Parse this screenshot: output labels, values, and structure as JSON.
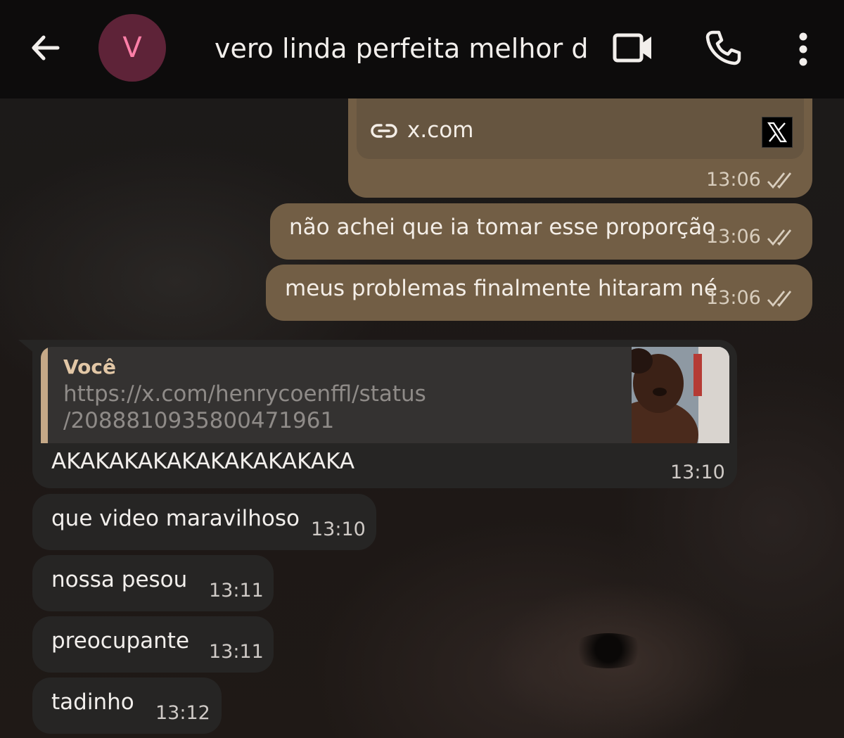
{
  "header": {
    "avatar_letter": "V",
    "contact_name": "vero linda perfeita melhor d...",
    "icons": [
      "arrow-back-icon",
      "video-call-icon",
      "phone-call-icon",
      "more-vert-icon"
    ]
  },
  "colors": {
    "outgoing_bubble": "#725e45",
    "incoming_bubble": "#262524",
    "avatar_bg": "#5e2338",
    "avatar_letter": "#ff7fa8",
    "reply_accent": "#c5a887"
  },
  "messages": {
    "link_preview": {
      "domain": "x.com",
      "time": "13:06",
      "brand_icon": "x-logo-icon"
    },
    "out1": {
      "text": "não achei que ia tomar esse proporção",
      "time": "13:06"
    },
    "out2": {
      "text": "meus problemas finalmente hitaram né",
      "time": "13:06"
    },
    "reply": {
      "author": "Você",
      "url_line1": "https://x.com/henrycoenffl/status",
      "url_line2": "/2088810935800471961",
      "text": "AKAKAKAKAKAKAKAKAKAKA",
      "time": "13:10"
    },
    "in1": {
      "text": "que video maravilhoso",
      "time": "13:10"
    },
    "in2": {
      "text": "nossa pesou",
      "time": "13:11"
    },
    "in3": {
      "text": "preocupante",
      "time": "13:11"
    },
    "in4": {
      "text": "tadinho",
      "time": "13:12"
    }
  }
}
